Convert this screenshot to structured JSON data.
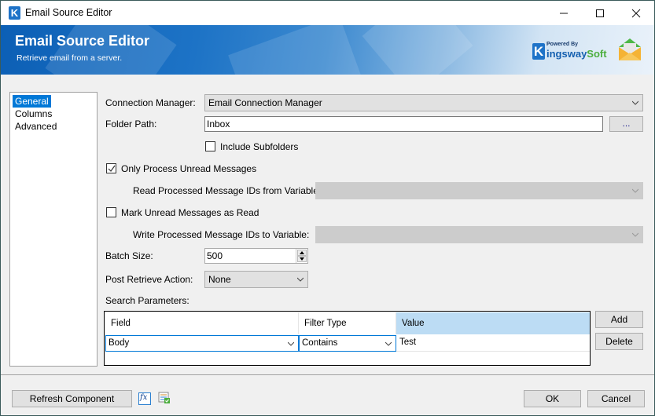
{
  "window": {
    "title": "Email Source Editor",
    "controls": {
      "minimize": "—",
      "maximize": "☐",
      "close": "✕"
    }
  },
  "banner": {
    "title": "Email Source Editor",
    "subtitle": "Retrieve email from a server.",
    "logo": {
      "powered_by": "Powered By",
      "brand_k": "K",
      "brand_main": "ingsway",
      "brand_soft": "Soft"
    }
  },
  "nav": {
    "items": [
      {
        "label": "General",
        "selected": true
      },
      {
        "label": "Columns",
        "selected": false
      },
      {
        "label": "Advanced",
        "selected": false
      }
    ]
  },
  "form": {
    "connection_manager": {
      "label": "Connection Manager:",
      "value": "Email Connection Manager"
    },
    "folder_path": {
      "label": "Folder Path:",
      "value": "Inbox",
      "browse_label": "..."
    },
    "include_subfolders": {
      "label": "Include Subfolders",
      "checked": false
    },
    "only_unread": {
      "label": "Only Process Unread Messages",
      "checked": true
    },
    "read_ids_variable": {
      "label": "Read Processed Message IDs from Variable:",
      "value": ""
    },
    "mark_as_read": {
      "label": "Mark Unread Messages as Read",
      "checked": false
    },
    "write_ids_variable": {
      "label": "Write Processed Message IDs to Variable:",
      "value": ""
    },
    "batch_size": {
      "label": "Batch Size:",
      "value": "500"
    },
    "post_retrieve_action": {
      "label": "Post Retrieve Action:",
      "value": "None"
    },
    "search_parameters": {
      "label": "Search Parameters:",
      "columns": [
        "Field",
        "Filter Type",
        "Value"
      ],
      "rows": [
        {
          "field": "Body",
          "filter_type": "Contains",
          "value": "Test"
        }
      ],
      "add_label": "Add",
      "delete_label": "Delete"
    }
  },
  "footer": {
    "refresh_label": "Refresh Component",
    "expression_icon": "fx",
    "ok_label": "OK",
    "cancel_label": "Cancel"
  },
  "colors": {
    "accent": "#0078d7",
    "banner_dark": "#0c5fb5",
    "selected_header": "#bcdcf4",
    "brand_green": "#4cae3e"
  }
}
